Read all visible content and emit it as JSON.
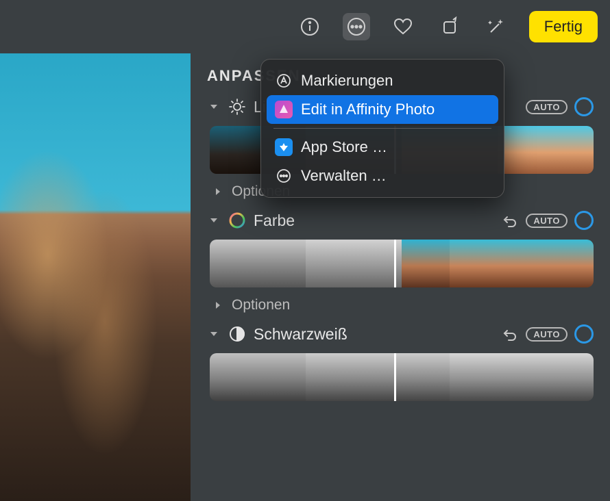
{
  "toolbar": {
    "done_label": "Fertig"
  },
  "sidebar": {
    "title": "ANPASSEN",
    "adjustments": [
      {
        "label": "Licht",
        "options_label": "Optionen",
        "auto": "AUTO"
      },
      {
        "label": "Farbe",
        "options_label": "Optionen",
        "auto": "AUTO"
      },
      {
        "label": "Schwarzweiß",
        "auto": "AUTO"
      }
    ]
  },
  "menu": {
    "items": [
      {
        "label": "Markierungen"
      },
      {
        "label": "Edit in Affinity Photo"
      },
      {
        "label": "App Store …"
      },
      {
        "label": "Verwalten …"
      }
    ]
  }
}
